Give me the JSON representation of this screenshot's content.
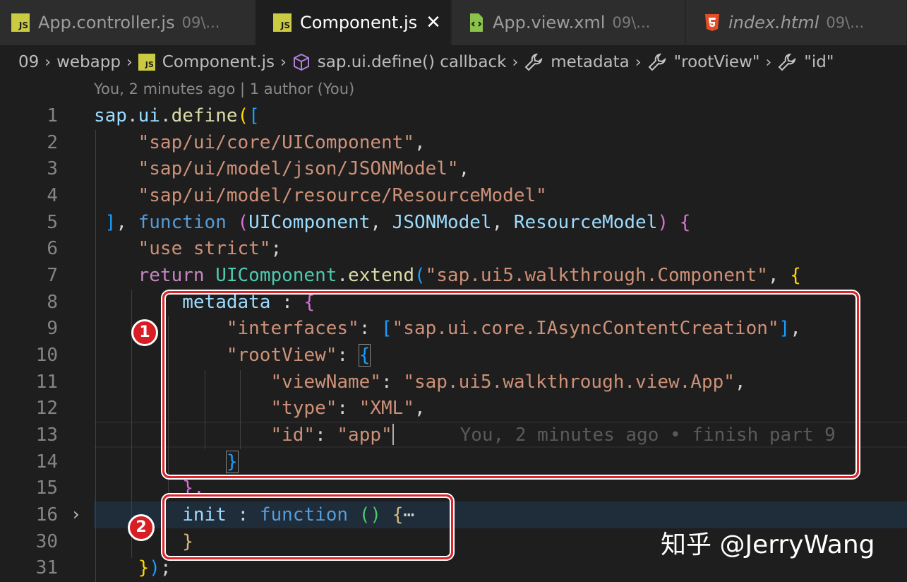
{
  "tabs": [
    {
      "icon": "js-file-icon",
      "icon_text": "JS",
      "name": "App.controller.js",
      "dir": "09\\...",
      "active": false
    },
    {
      "icon": "js-file-icon",
      "icon_text": "JS",
      "name": "Component.js",
      "close": "✕",
      "active": true
    },
    {
      "icon": "xml-file-icon",
      "name": "App.view.xml",
      "dir": "09\\...",
      "active": false
    },
    {
      "icon": "html5-file-icon",
      "name": "index.html",
      "dir": "09\\...",
      "active": false
    }
  ],
  "breadcrumbs": {
    "folder1": "09",
    "folder2": "webapp",
    "file_icon_text": "JS",
    "file": "Component.js",
    "symbol1": "sap.ui.define() callback",
    "symbol2": "metadata",
    "symbol3": "\"rootView\"",
    "symbol4": "\"id\"",
    "separator": "›"
  },
  "blame_header": "You, 2 minutes ago | 1 author (You)",
  "line_numbers": [
    "1",
    "2",
    "3",
    "4",
    "5",
    "6",
    "7",
    "8",
    "9",
    "10",
    "11",
    "12",
    "13",
    "14",
    "15",
    "16",
    "30",
    "31"
  ],
  "fold_chevron": "›",
  "code": {
    "l1": [
      "sap",
      ".",
      "ui",
      ".",
      "define",
      "(",
      "["
    ],
    "l2": [
      "\"sap/ui/core/UIComponent\"",
      ","
    ],
    "l3": [
      "\"sap/ui/model/json/JSONModel\"",
      ","
    ],
    "l4": [
      "\"sap/ui/model/resource/ResourceModel\""
    ],
    "l5": [
      "]",
      ", ",
      "function",
      " ",
      "(",
      "UIComponent",
      ", ",
      "JSONModel",
      ", ",
      "ResourceModel",
      ")",
      " ",
      "{"
    ],
    "l6": [
      "\"use strict\"",
      ";"
    ],
    "l7": [
      "return",
      " ",
      "UIComponent",
      ".",
      "extend",
      "(",
      "\"sap.ui5.walkthrough.Component\"",
      ", ",
      "{"
    ],
    "l8": [
      "metadata",
      " : ",
      "{"
    ],
    "l9": [
      "\"interfaces\"",
      ": ",
      "[",
      "\"sap.ui.core.IAsyncContentCreation\"",
      "]",
      ","
    ],
    "l10": [
      "\"rootView\"",
      ": ",
      "{"
    ],
    "l11": [
      "\"viewName\"",
      ": ",
      "\"sap.ui5.walkthrough.view.App\"",
      ","
    ],
    "l12": [
      "\"type\"",
      ": ",
      "\"XML\"",
      ","
    ],
    "l13": [
      "\"id\"",
      ": ",
      "\"app\""
    ],
    "l13_blame": "You, 2 minutes ago • finish part 9",
    "l14": [
      "}"
    ],
    "l15": [
      "},"
    ],
    "l16": [
      "init",
      " : ",
      "function",
      " ",
      "()",
      " ",
      "{",
      "⋯"
    ],
    "l30": [
      "}"
    ],
    "l31": [
      "}",
      ")",
      ";"
    ]
  },
  "annotations": [
    "1",
    "2"
  ],
  "watermark": "知乎 @JerryWang"
}
